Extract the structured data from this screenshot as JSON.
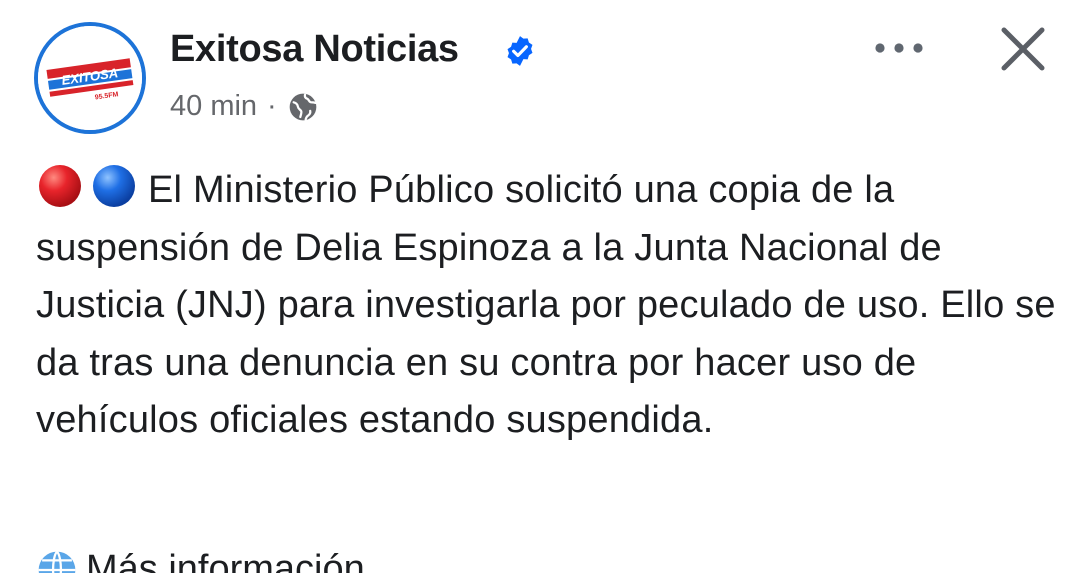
{
  "header": {
    "page_name": "Exitosa Noticias",
    "time_ago": "40 min",
    "separator": "·",
    "avatar_logo_text": "EXITOSA",
    "avatar_logo_subtext": "95.5FM",
    "verified_icon": "verified-badge-icon",
    "audience_icon": "globe-icon",
    "more_icon": "more-options-icon",
    "close_icon": "close-icon"
  },
  "post": {
    "emoji": "red-blue-circles",
    "text": "El Ministerio Público solicitó una copia de la suspensión de Delia Espinoza a la Junta Nacional de Justicia (JNJ) para investigarla por peculado de uso. Ello se da tras una denuncia en su contra por hacer uso de vehículos oficiales estando suspendida."
  },
  "footer": {
    "more_info_label": "Más información"
  },
  "colors": {
    "brand_blue": "#1d73d8",
    "brand_red": "#d8232a",
    "verified_blue": "#0866ff",
    "secondary_text": "#65676b",
    "primary_text": "#1c1e21"
  }
}
